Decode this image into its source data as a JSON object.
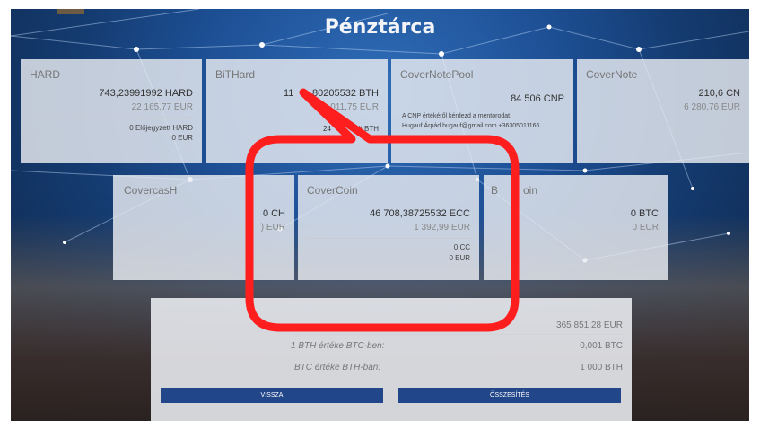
{
  "page": {
    "title": "Pénztárca"
  },
  "cards": {
    "hard": {
      "name": "HARD",
      "amount": "743,23991992 HARD",
      "eur": "22 165,77 EUR",
      "reserved_label": "0 Előjegyzett HARD",
      "reserved_eur": "0 EUR"
    },
    "bithard": {
      "name": "BiTHard",
      "amount_prefix": "11",
      "amount_rest": "80205532 BTH",
      "eur": ",011,75 EUR",
      "reserved_label": "24",
      "reserved_suffix": "elt BTH",
      "reserved_eur": "7 3"
    },
    "covernotepool": {
      "name": "CoverNotePool",
      "amount": "84 506 CNP",
      "info_line1": "A CNP értékéről kérdezd a mentorodat.",
      "info_line2": "Hugauf Árpád hugauf@gmail.com +36305011166"
    },
    "covernote": {
      "name": "CoverNote",
      "amount": "210,6 CN",
      "eur": "6 280,76 EUR"
    },
    "covercash": {
      "name": "CovercasH",
      "amount": "0 CH",
      "eur": ") EUR"
    },
    "covercoin": {
      "name": "CoverCoin",
      "amount": "46 708,38725532 ECC",
      "eur": "1 392,99 EUR",
      "reserved_label": "0 CC",
      "reserved_eur": "0 EUR"
    },
    "bitcoin": {
      "name_start": "B",
      "name_end": "oin",
      "amount": "0 BTC",
      "eur": "0 EUR"
    }
  },
  "summary": {
    "total_label": "",
    "total_value": "365 851,28 EUR",
    "bth_label": "1 BTH értéke BTC-ben:",
    "bth_value": "0,001 BTC",
    "btc_label": "BTC értéke BTH-ban:",
    "btc_value": "1 000 BTH"
  },
  "buttons": {
    "back": "VISSZA",
    "total": "ÖSSZESÍTÉS"
  },
  "colors": {
    "accent": "#22468a",
    "callout": "#ff1e1e"
  }
}
